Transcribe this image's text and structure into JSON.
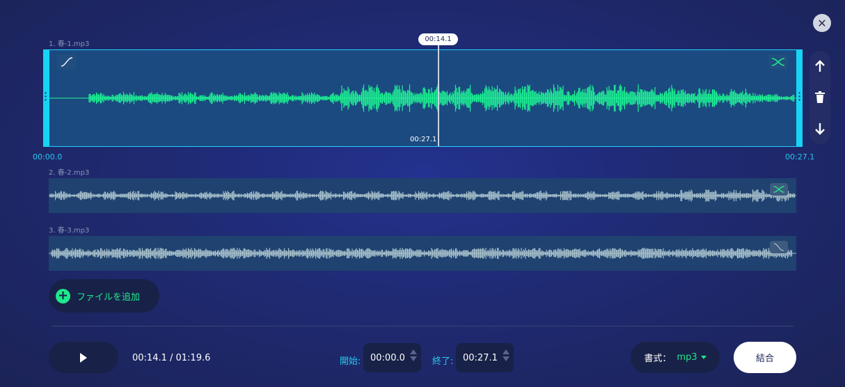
{
  "close": {
    "icon": "close-icon",
    "glyph": "✕"
  },
  "tracks": [
    {
      "label": "1. 春-1.mp3",
      "duration": "00:27.1",
      "start_mark": "00:00.0",
      "end_mark": "00:27.1",
      "color": "#1df594",
      "active": true
    },
    {
      "label": "2. 春-2.mp3",
      "color": "#a9c2cc",
      "active": false
    },
    {
      "label": "3. 春-3.mp3",
      "color": "#a9c2cc",
      "active": false
    }
  ],
  "playhead": {
    "time": "00:14.1"
  },
  "side_controls": {
    "move_up": "arrow-up-icon",
    "delete": "trash-icon",
    "move_down": "arrow-down-icon"
  },
  "add_file": {
    "label": "ファイルを追加"
  },
  "playback": {
    "current": "00:14.1 / 01:19.6"
  },
  "range": {
    "start_label": "開始:",
    "start_value": "00:00.0",
    "end_label": "終了:",
    "end_value": "00:27.1"
  },
  "format": {
    "label": "書式：",
    "value": "mp3"
  },
  "merge": {
    "label": "結合"
  },
  "colors": {
    "accent": "#1de98b",
    "cyan": "#17d4f5",
    "track_active": "#1b4a80",
    "track_inactive": "#1f4270"
  }
}
